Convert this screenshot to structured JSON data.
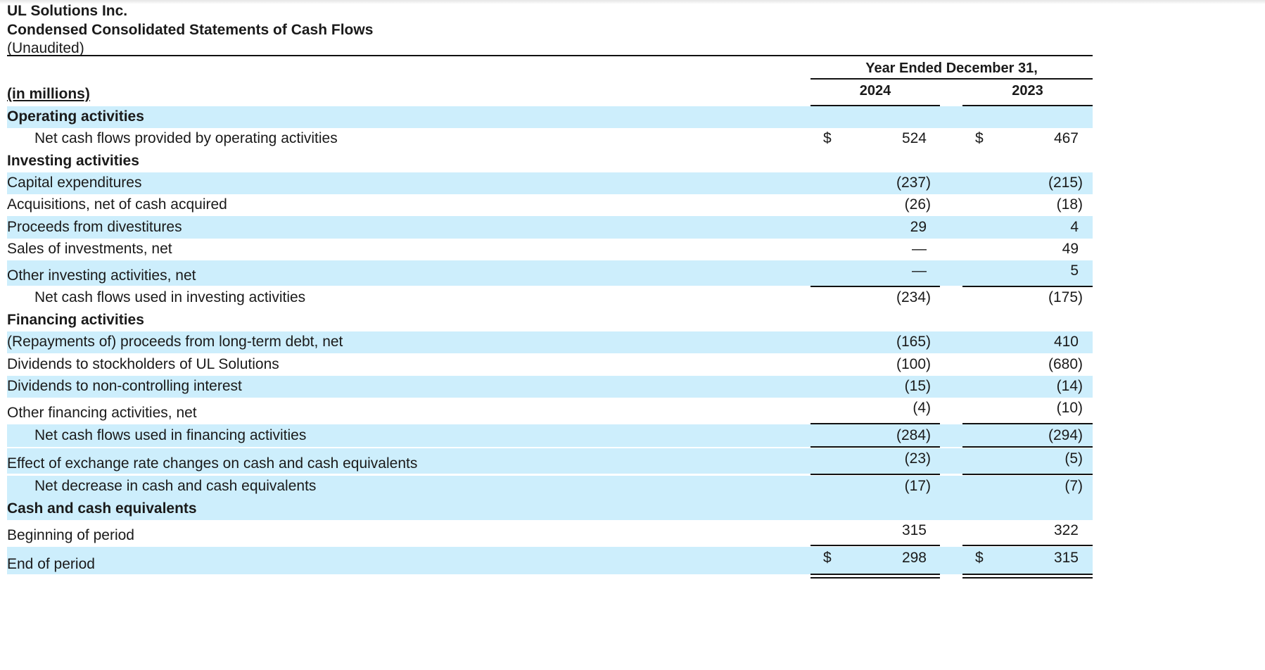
{
  "header": {
    "company": "UL Solutions Inc.",
    "statement": "Condensed Consolidated Statements of Cash Flows",
    "unaudited": "(Unaudited)",
    "units": "(in millions)",
    "period": "Year Ended December 31,",
    "year1": "2024",
    "year2": "2023"
  },
  "currency": "$",
  "rows": {
    "op_heading": "Operating activities",
    "op_net": {
      "label": "Net cash flows provided by operating activities",
      "v2024": "524",
      "v2023": "467"
    },
    "inv_heading": "Investing activities",
    "capex": {
      "label": "Capital expenditures",
      "v2024": "(237)",
      "v2023": "(215)"
    },
    "acq": {
      "label": "Acquisitions, net of cash acquired",
      "v2024": "(26)",
      "v2023": "(18)"
    },
    "divest": {
      "label": "Proceeds from divestitures",
      "v2024": "29",
      "v2023": "4"
    },
    "sales_inv": {
      "label": "Sales of investments, net",
      "v2024": "—",
      "v2023": "49"
    },
    "other_inv": {
      "label": "Other investing activities, net",
      "v2024": "—",
      "v2023": "5"
    },
    "inv_net": {
      "label": "Net cash flows used in investing activities",
      "v2024": "(234)",
      "v2023": "(175)"
    },
    "fin_heading": "Financing activities",
    "debt": {
      "label": "(Repayments of) proceeds from long-term debt, net",
      "v2024": "(165)",
      "v2023": "410"
    },
    "div_ul": {
      "label": "Dividends to stockholders of UL Solutions",
      "v2024": "(100)",
      "v2023": "(680)"
    },
    "div_nci": {
      "label": "Dividends to non-controlling interest",
      "v2024": "(15)",
      "v2023": "(14)"
    },
    "other_fin": {
      "label": "Other financing activities, net",
      "v2024": "(4)",
      "v2023": "(10)"
    },
    "fin_net": {
      "label": "Net cash flows used in financing activities",
      "v2024": "(284)",
      "v2023": "(294)"
    },
    "fx": {
      "label": "Effect of exchange rate changes on cash and cash equivalents",
      "v2024": "(23)",
      "v2023": "(5)"
    },
    "net_decrease": {
      "label": "Net decrease in cash and cash equivalents",
      "v2024": "(17)",
      "v2023": "(7)"
    },
    "cash_heading": "Cash and cash equivalents",
    "begin": {
      "label": "Beginning of period",
      "v2024": "315",
      "v2023": "322"
    },
    "end": {
      "label": "End of period",
      "v2024": "298",
      "v2023": "315"
    }
  }
}
